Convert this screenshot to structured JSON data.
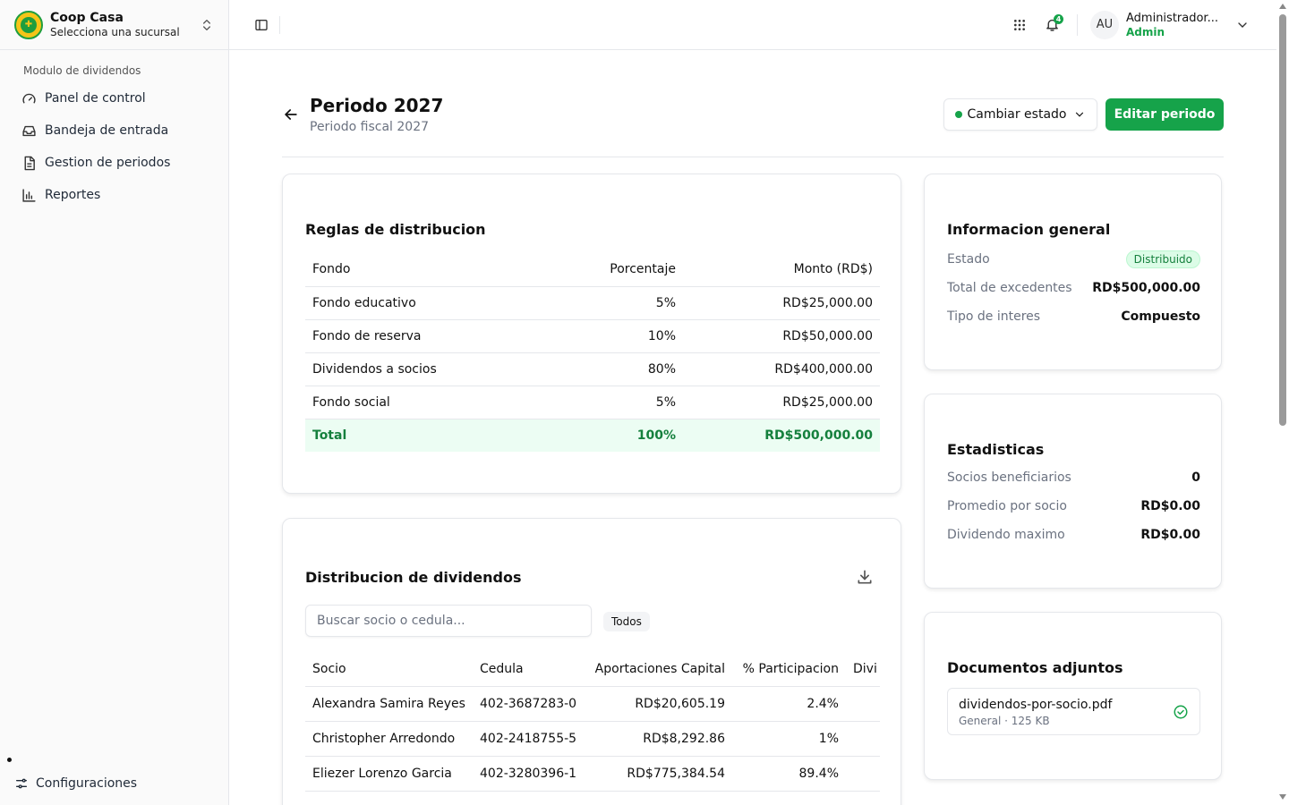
{
  "sidebar": {
    "brand_title": "Coop Casa",
    "brand_subtitle": "Selecciona una sucursal",
    "group_label": "Modulo de dividendos",
    "items": [
      {
        "label": "Panel de control",
        "icon": "gauge-icon"
      },
      {
        "label": "Bandeja de entrada",
        "icon": "inbox-icon"
      },
      {
        "label": "Gestion de periodos",
        "icon": "file-icon"
      },
      {
        "label": "Reportes",
        "icon": "bar-chart-icon"
      }
    ],
    "settings_label": "Configuraciones"
  },
  "header": {
    "notification_count": "4",
    "avatar_initials": "AU",
    "user_name": "Administrador...",
    "user_role": "Admin"
  },
  "page": {
    "title": "Periodo 2027",
    "subtitle": "Periodo fiscal 2027",
    "change_state_label": "Cambiar estado",
    "edit_label": "Editar periodo"
  },
  "rules": {
    "title": "Reglas de distribucion",
    "columns": [
      "Fondo",
      "Porcentaje",
      "Monto (RD$)"
    ],
    "rows": [
      [
        "Fondo educativo",
        "5%",
        "RD$25,000.00"
      ],
      [
        "Fondo de reserva",
        "10%",
        "RD$50,000.00"
      ],
      [
        "Dividendos a socios",
        "80%",
        "RD$400,000.00"
      ],
      [
        "Fondo social",
        "5%",
        "RD$25,000.00"
      ]
    ],
    "total": [
      "Total",
      "100%",
      "RD$500,000.00"
    ]
  },
  "distribution": {
    "title": "Distribucion de dividendos",
    "search_placeholder": "Buscar socio o cedula...",
    "filter_label": "Todos",
    "columns": [
      "Socio",
      "Cedula",
      "Aportaciones Capital",
      "% Participacion",
      "Divi"
    ],
    "rows": [
      [
        "Alexandra Samira Reyes",
        "402-3687283-0",
        "RD$20,605.19",
        "2.4%",
        ""
      ],
      [
        "Christopher Arredondo",
        "402-2418755-5",
        "RD$8,292.86",
        "1%",
        ""
      ],
      [
        "Eliezer Lorenzo Garcia",
        "402-3280396-1",
        "RD$775,384.54",
        "89.4%",
        ""
      ]
    ]
  },
  "general_info": {
    "title": "Informacion general",
    "state_label": "Estado",
    "state_value": "Distribuido",
    "surplus_label": "Total de excedentes",
    "surplus_value": "RD$500,000.00",
    "interest_label": "Tipo de interes",
    "interest_value": "Compuesto"
  },
  "stats": {
    "title": "Estadisticas",
    "members_label": "Socios beneficiarios",
    "members_value": "0",
    "avg_label": "Promedio por socio",
    "avg_value": "RD$0.00",
    "max_label": "Dividendo maximo",
    "max_value": "RD$0.00"
  },
  "documents": {
    "title": "Documentos adjuntos",
    "file_name": "dividendos-por-socio.pdf",
    "file_meta": "General · 125 KB"
  },
  "colors": {
    "accent": "#16a34a",
    "total_row_bg": "#ecfdf3"
  }
}
